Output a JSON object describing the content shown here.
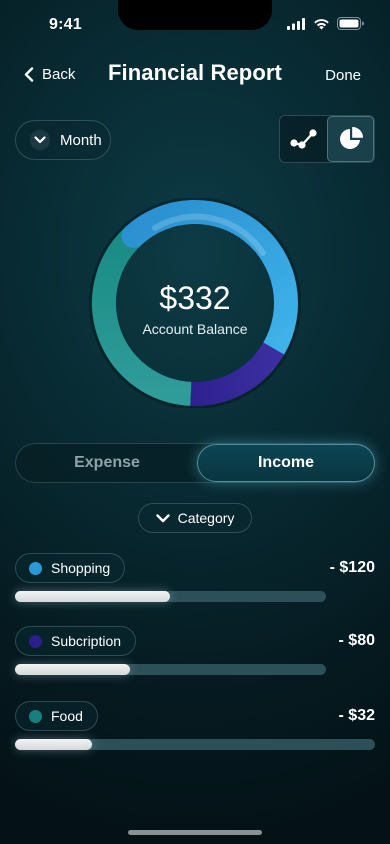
{
  "status_bar": {
    "time": "9:41"
  },
  "nav": {
    "back_label": "Back",
    "title": "Financial Report",
    "done_label": "Done"
  },
  "period": {
    "selected": "Month"
  },
  "chart_toggle": {
    "options": [
      "line-chart-icon",
      "pie-chart-icon"
    ],
    "active": "pie-chart-icon"
  },
  "summary": {
    "balance": "$332",
    "balance_label": "Account Balance"
  },
  "type_switch": {
    "options": [
      "Expense",
      "Income"
    ],
    "active": "Income"
  },
  "category_filter": {
    "label": "Category"
  },
  "categories": [
    {
      "name": "Shopping",
      "amount": "- $120",
      "color": "#2a9ad6",
      "progress": 0.5
    },
    {
      "name": "Subcription",
      "amount": "- $80",
      "color": "#2b1f8a",
      "progress": 0.37
    },
    {
      "name": "Food",
      "amount": "- $32",
      "color": "#17807c",
      "progress": 0.22
    }
  ],
  "colors": {
    "accent": "#2a9ad6",
    "background": "#082a32"
  }
}
